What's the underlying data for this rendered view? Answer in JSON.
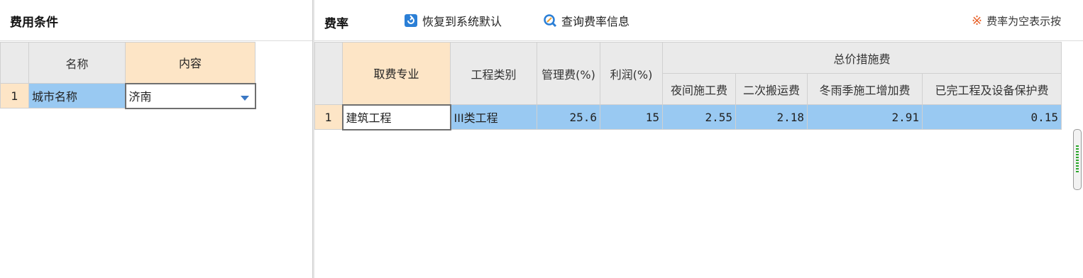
{
  "left": {
    "title": "费用条件",
    "columns": {
      "name": "名称",
      "content": "内容"
    },
    "rows": [
      {
        "num": "1",
        "name": "城市名称",
        "content": "济南"
      }
    ]
  },
  "right": {
    "title": "费率",
    "restore_label": "恢复到系统默认",
    "query_label": "查询费率信息",
    "note_symbol": "※",
    "note_text": "费率为空表示按",
    "columns": {
      "major": "取费专业",
      "category": "工程类别",
      "mgmt": "管理费(%)",
      "profit": "利润(%)",
      "measures_group": "总价措施费",
      "night": "夜间施工费",
      "secondary": "二次搬运费",
      "winter": "冬雨季施工增加费",
      "protect": "已完工程及设备保护费"
    },
    "rows": [
      {
        "num": "1",
        "major": "建筑工程",
        "category": "III类工程",
        "mgmt": "25.6",
        "profit": "15",
        "night": "2.55",
        "secondary": "2.18",
        "winter": "2.91",
        "protect": "0.15"
      }
    ]
  },
  "colors": {
    "selected_row": "#99c9f2",
    "key_header": "#fde5c6",
    "header": "#eaeaea",
    "accent_icon": "#2b7fd6",
    "note_symbol": "#e8622a"
  }
}
